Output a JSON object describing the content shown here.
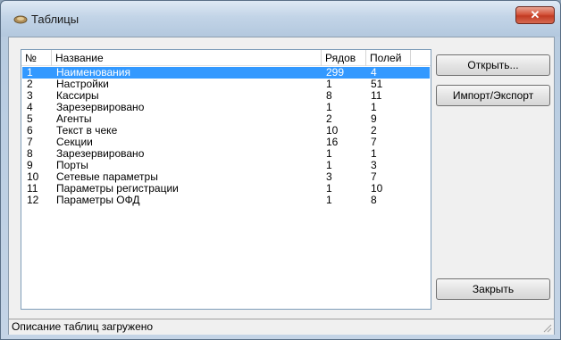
{
  "window": {
    "title": "Таблицы",
    "close_symbol": "✕"
  },
  "list": {
    "columns": [
      "№",
      "Название",
      "Рядов",
      "Полей"
    ],
    "rows": [
      {
        "num": "1",
        "name": "Наименования",
        "rows": "299",
        "fields": "4",
        "selected": true
      },
      {
        "num": "2",
        "name": "Настройки",
        "rows": "1",
        "fields": "51"
      },
      {
        "num": "3",
        "name": "Кассиры",
        "rows": "8",
        "fields": "11"
      },
      {
        "num": "4",
        "name": "Зарезервировано",
        "rows": "1",
        "fields": "1"
      },
      {
        "num": "5",
        "name": "Агенты",
        "rows": "2",
        "fields": "9"
      },
      {
        "num": "6",
        "name": "Текст в чеке",
        "rows": "10",
        "fields": "2"
      },
      {
        "num": "7",
        "name": "Секции",
        "rows": "16",
        "fields": "7"
      },
      {
        "num": "8",
        "name": "Зарезервировано",
        "rows": "1",
        "fields": "1"
      },
      {
        "num": "9",
        "name": "Порты",
        "rows": "1",
        "fields": "3"
      },
      {
        "num": "10",
        "name": "Сетевые параметры",
        "rows": "3",
        "fields": "7"
      },
      {
        "num": "11",
        "name": "Параметры регистрации",
        "rows": "1",
        "fields": "10"
      },
      {
        "num": "12",
        "name": "Параметры ОФД",
        "rows": "1",
        "fields": "8"
      }
    ]
  },
  "buttons": {
    "open": "Открыть...",
    "import_export": "Импорт/Экспорт",
    "close": "Закрыть"
  },
  "status": {
    "text": "Описание таблиц загружено"
  },
  "colors": {
    "selection": "#3399ff",
    "close_button": "#c23a22"
  },
  "icons": {
    "title": "tables-icon",
    "close": "close-icon",
    "grip": "resize-grip-icon"
  }
}
